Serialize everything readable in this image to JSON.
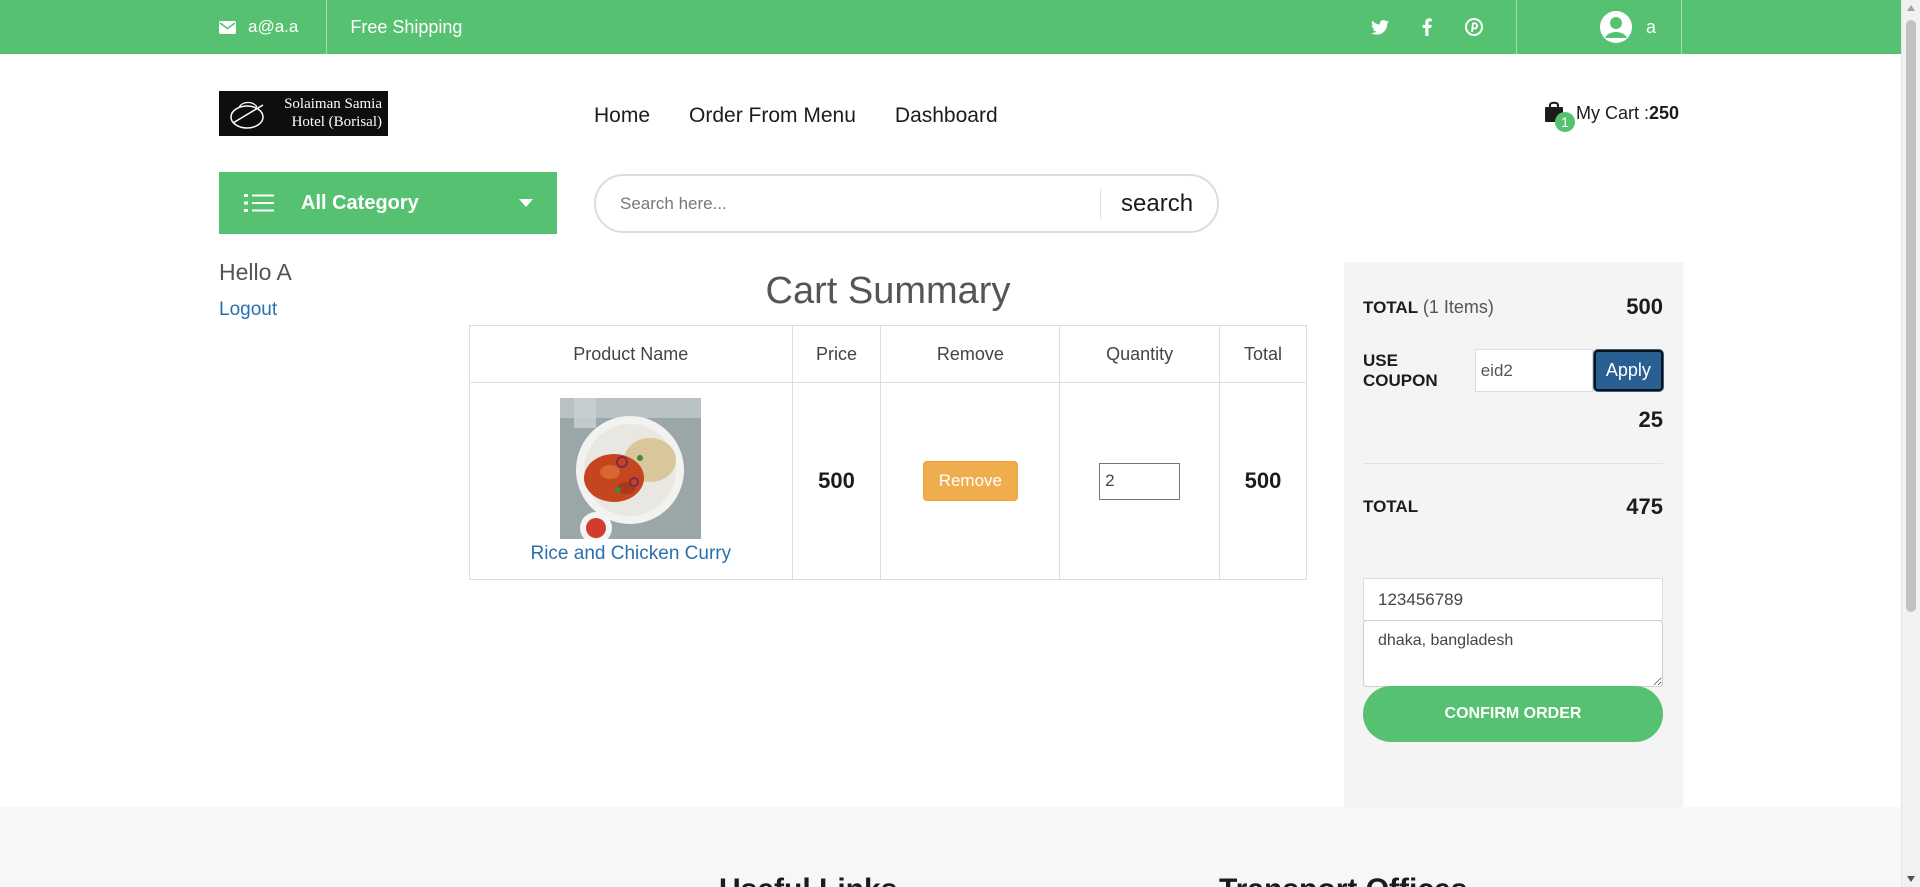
{
  "topbar": {
    "email": "a@a.a",
    "shipping": "Free Shipping",
    "social": [
      "twitter-icon",
      "facebook-icon",
      "pinterest-icon"
    ],
    "user_name": "a"
  },
  "header": {
    "logo_line1": "Solaiman Samia",
    "logo_line2": "Hotel (Borisal)",
    "nav": [
      "Home",
      "Order From Menu",
      "Dashboard"
    ],
    "cart_count": "1",
    "cart_label": "My Cart :",
    "cart_amount": "250"
  },
  "category": {
    "label": "All Category"
  },
  "search": {
    "placeholder": "Search here...",
    "button": "search"
  },
  "sidebar": {
    "hello": "Hello A",
    "logout": "Logout"
  },
  "summary": {
    "title": "Cart Summary",
    "columns": [
      "Product Name",
      "Price",
      "Remove",
      "Quantity",
      "Total"
    ],
    "rows": [
      {
        "product": "Rice and Chicken Curry",
        "price": "500",
        "remove": "Remove",
        "quantity": "2",
        "total": "500"
      }
    ]
  },
  "order": {
    "total_label": "TOTAL",
    "items_label": "(1 Items)",
    "total_value": "500",
    "coupon_label": "USE COUPON",
    "coupon_value": "eid2",
    "apply": "Apply",
    "discount": "25",
    "grand_label": "TOTAL",
    "grand_value": "475",
    "phone": "123456789",
    "address": "dhaka, bangladesh",
    "confirm": "CONFIRM ORDER"
  },
  "footer": {
    "heading1": "Useful Links",
    "heading2": "Transport Offices"
  },
  "colors": {
    "brand_green": "#56c271",
    "link_blue": "#2a6fb0",
    "apply_blue": "#2a5f94",
    "remove_orange": "#f0ad4e"
  }
}
